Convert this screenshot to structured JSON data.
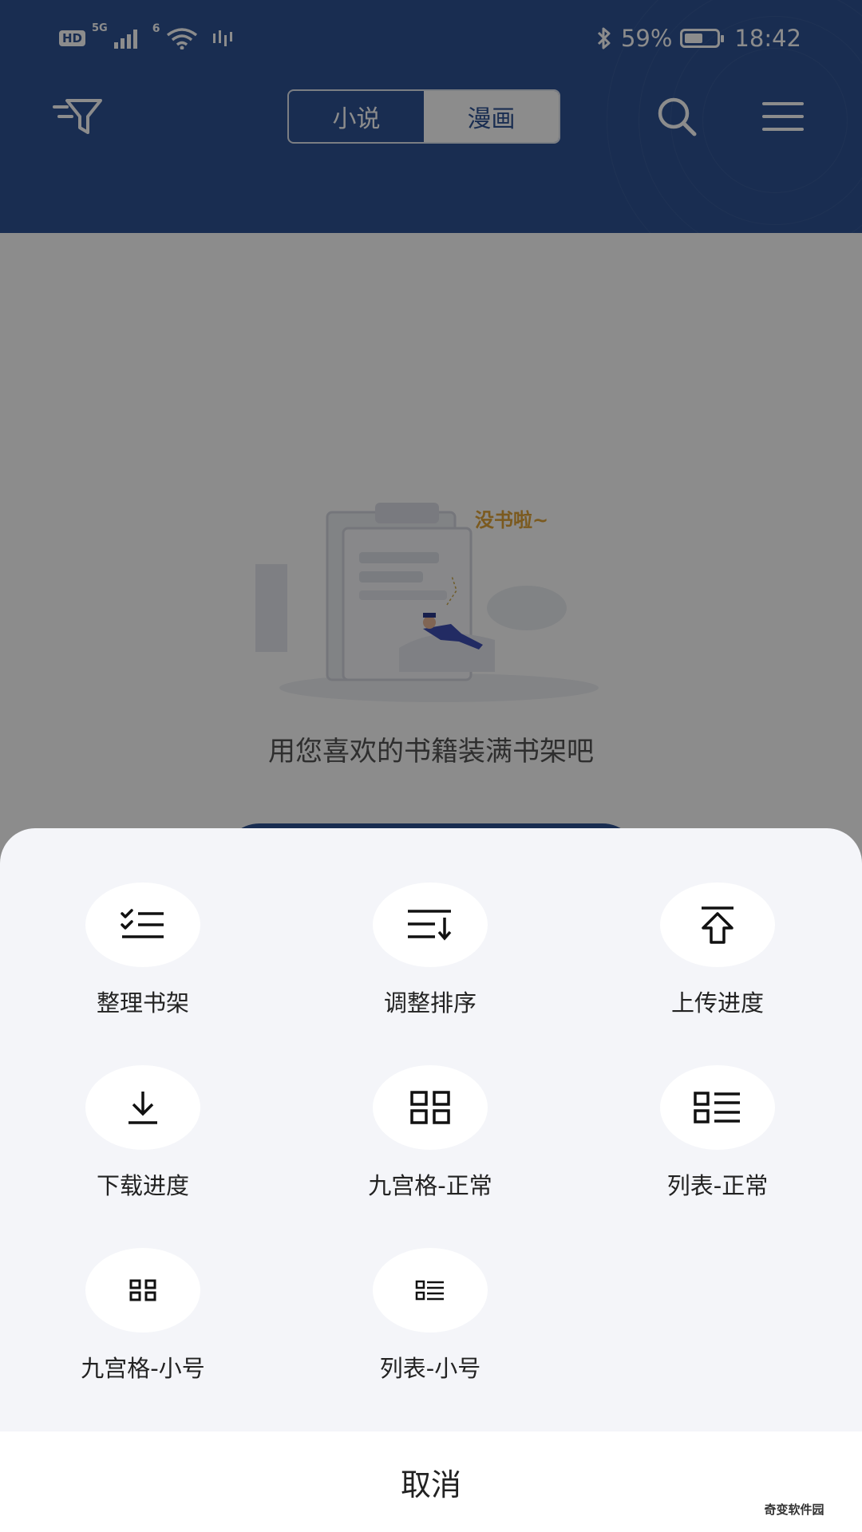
{
  "status_bar": {
    "badge": "HD",
    "network_1": "5G",
    "network_2": "6",
    "battery_percent": "59%",
    "battery_level": 0.59,
    "time": "18:42"
  },
  "header": {
    "tabs": [
      {
        "label": "小说",
        "active": false
      },
      {
        "label": "漫画",
        "active": true
      }
    ],
    "icons": [
      "filter-icon",
      "search-icon",
      "menu-icon"
    ]
  },
  "empty_state": {
    "illustration_text": "没书啦~",
    "message": "用您喜欢的书籍装满书架吧"
  },
  "sheet": {
    "items": [
      {
        "label": "整理书架",
        "icon": "checklist-icon"
      },
      {
        "label": "调整排序",
        "icon": "sort-icon"
      },
      {
        "label": "上传进度",
        "icon": "upload-icon"
      },
      {
        "label": "下载进度",
        "icon": "download-icon"
      },
      {
        "label": "九宫格-正常",
        "icon": "grid-icon"
      },
      {
        "label": "列表-正常",
        "icon": "list-icon"
      },
      {
        "label": "九宫格-小号",
        "icon": "grid-small-icon"
      },
      {
        "label": "列表-小号",
        "icon": "list-small-icon"
      }
    ],
    "cancel_label": "取消"
  },
  "watermark": "奇变软件园",
  "colors": {
    "header_bg": "#2f5394",
    "sheet_bg": "#f4f5f9",
    "overlay": "rgba(0,0,0,0.45)"
  }
}
